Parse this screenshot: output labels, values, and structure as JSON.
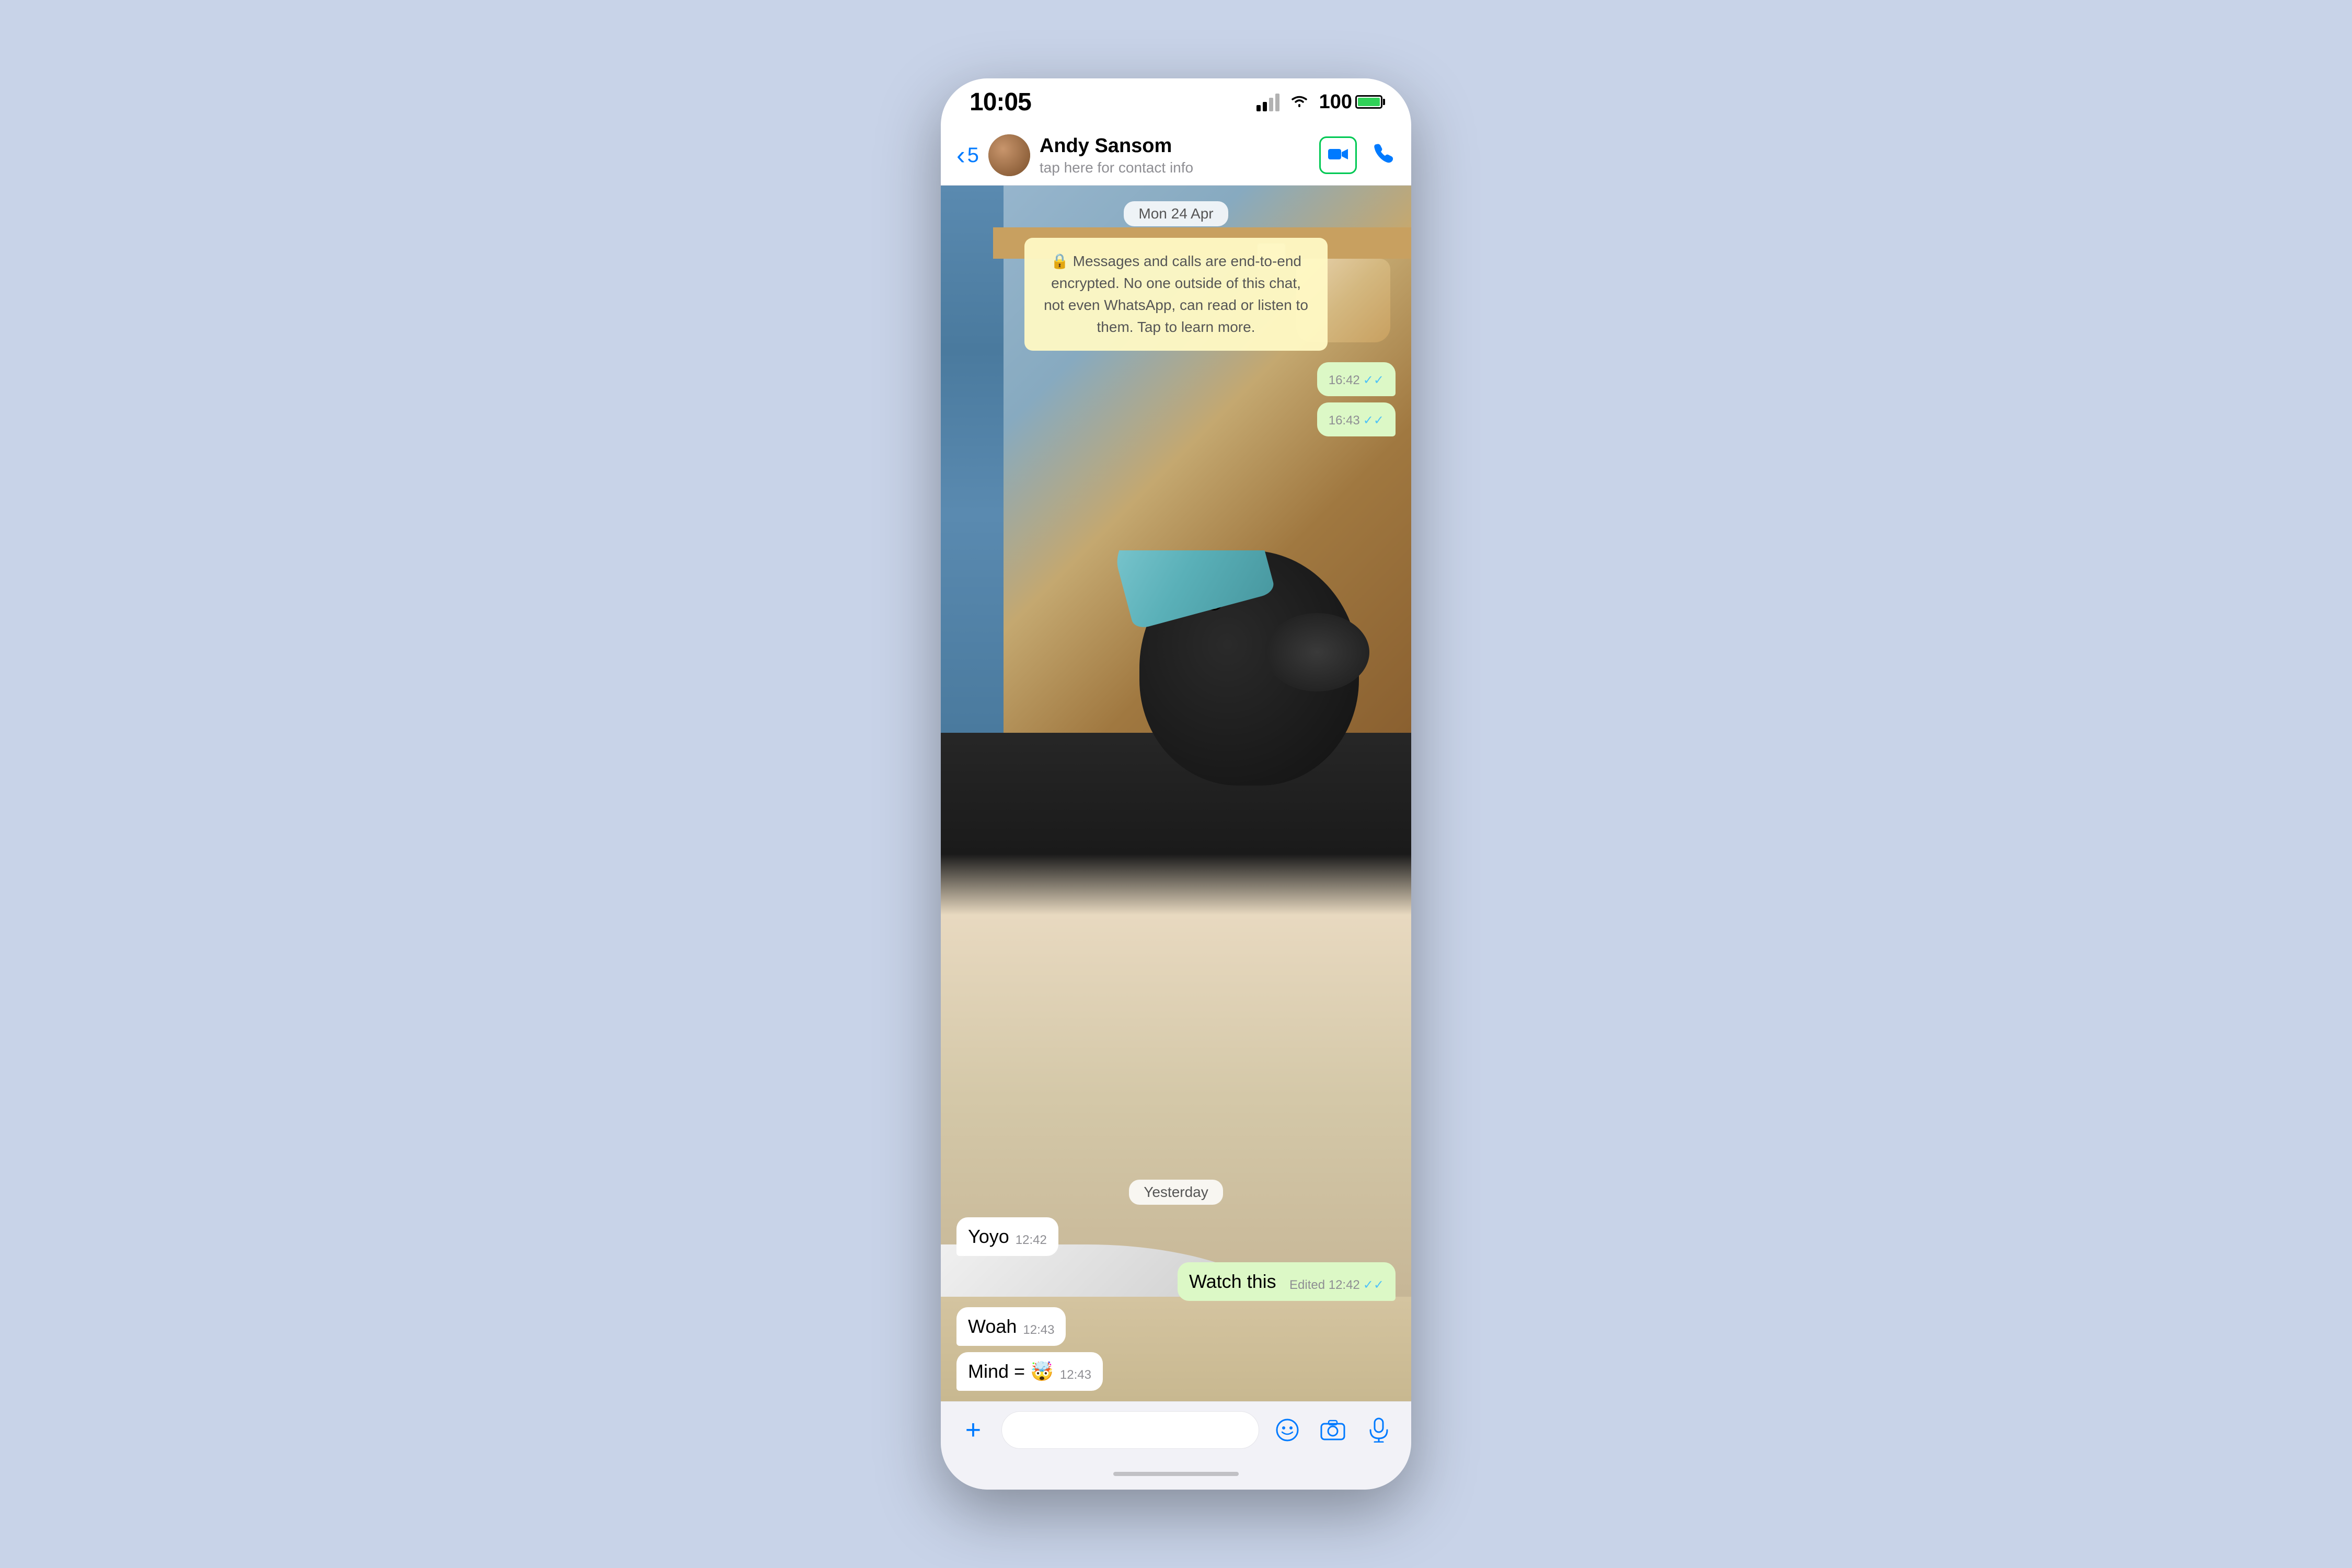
{
  "statusBar": {
    "time": "10:05",
    "battery": "100"
  },
  "header": {
    "backCount": "5",
    "contactName": "Andy Sansom",
    "contactSubtitle": "tap here for contact info",
    "videoCallLabel": "Video call",
    "phoneCallLabel": "Phone call"
  },
  "chat": {
    "dateBadge": "Mon 24 Apr",
    "encryptionNotice": "🔒 Messages and calls are end-to-end encrypted. No one outside of this chat, not even WhatsApp, can read or listen to them. Tap to learn more.",
    "yesterdayBadge": "Yesterday",
    "messages": [
      {
        "id": "out1",
        "type": "outgoing",
        "time": "16:42",
        "hasCheck": true
      },
      {
        "id": "out2",
        "type": "outgoing",
        "time": "16:43",
        "hasCheck": true
      },
      {
        "id": "in1",
        "type": "incoming",
        "text": "Yoyo",
        "time": "12:42"
      },
      {
        "id": "out3",
        "type": "outgoing",
        "text": "Watch this",
        "edited": "Edited",
        "time": "12:42",
        "hasCheck": true
      },
      {
        "id": "in2",
        "type": "incoming",
        "text": "Woah",
        "time": "12:43"
      },
      {
        "id": "in3",
        "type": "incoming",
        "text": "Mind = 🤯",
        "time": "12:43"
      }
    ]
  },
  "inputBar": {
    "placeholder": "",
    "plusLabel": "+",
    "stickerLabel": "⊕",
    "cameraLabel": "📷",
    "micLabel": "🎤"
  }
}
